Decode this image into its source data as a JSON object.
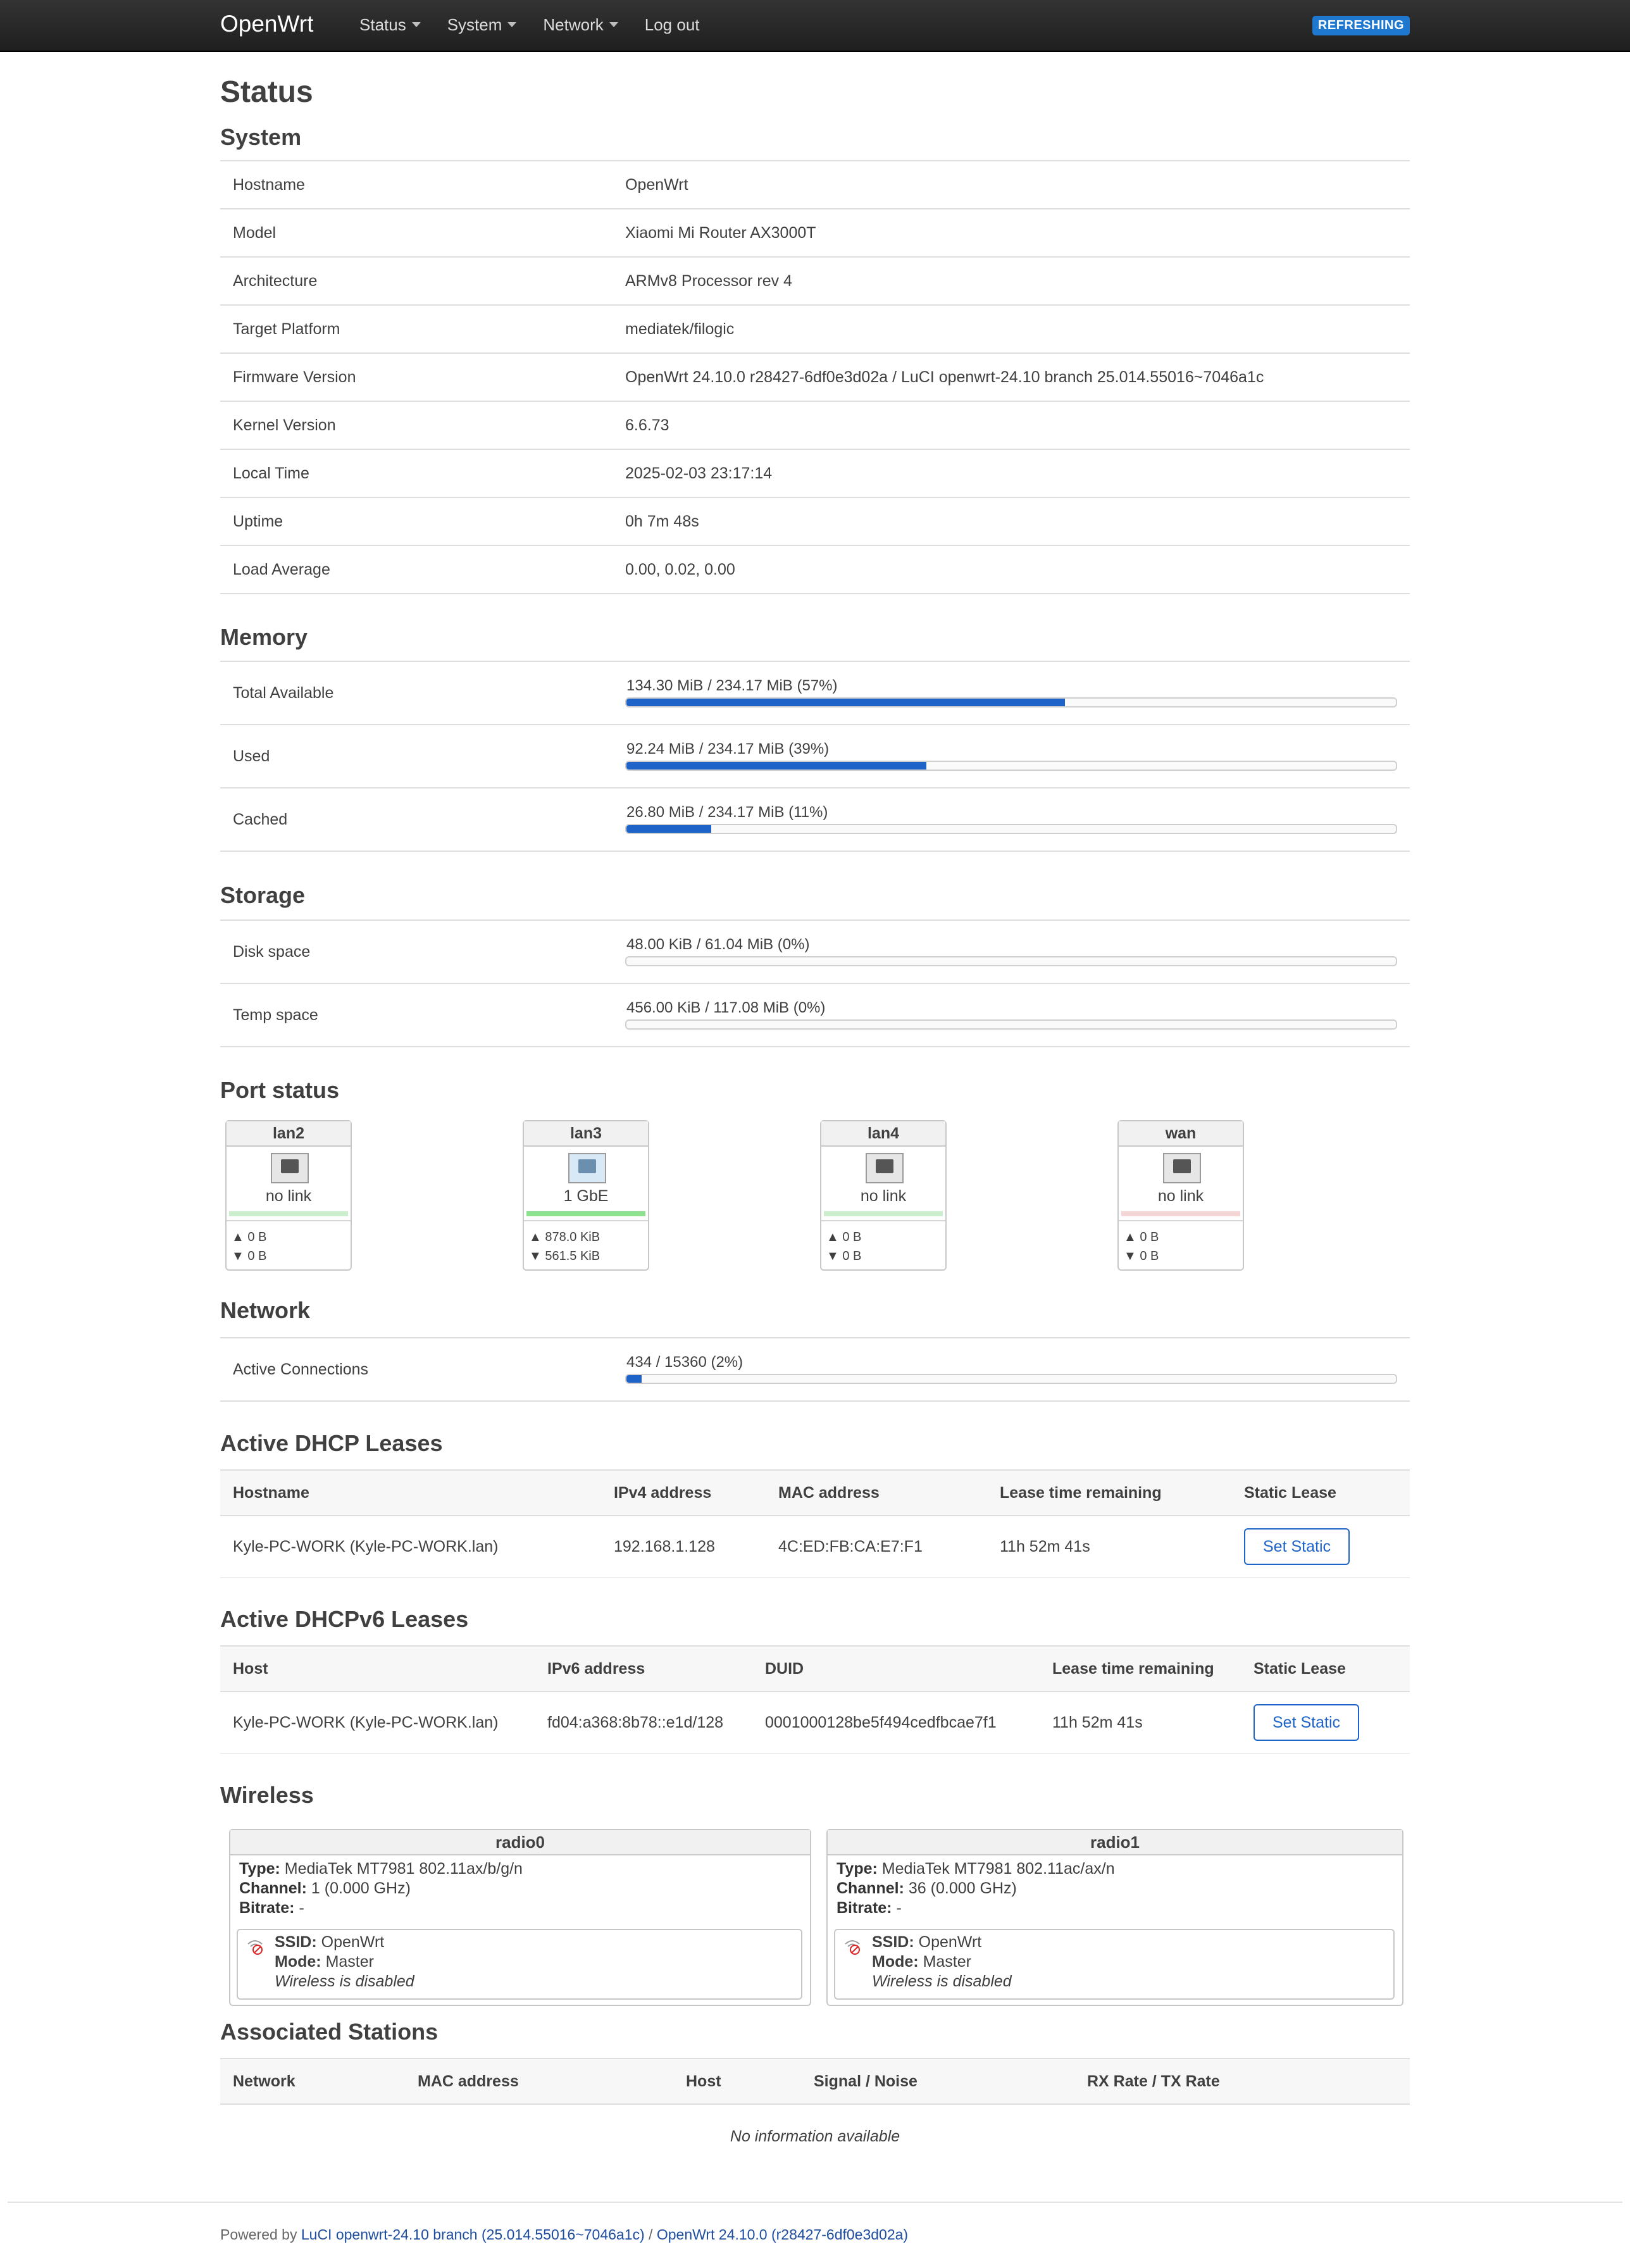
{
  "header": {
    "brand": "OpenWrt",
    "menu": [
      {
        "label": "Status",
        "dropdown": true
      },
      {
        "label": "System",
        "dropdown": true
      },
      {
        "label": "Network",
        "dropdown": true
      },
      {
        "label": "Log out",
        "dropdown": false
      }
    ],
    "badge": "REFRESHING"
  },
  "page_title": "Status",
  "system": {
    "title": "System",
    "rows": [
      {
        "label": "Hostname",
        "value": "OpenWrt"
      },
      {
        "label": "Model",
        "value": "Xiaomi Mi Router AX3000T"
      },
      {
        "label": "Architecture",
        "value": "ARMv8 Processor rev 4"
      },
      {
        "label": "Target Platform",
        "value": "mediatek/filogic"
      },
      {
        "label": "Firmware Version",
        "value": "OpenWrt 24.10.0 r28427-6df0e3d02a / LuCI openwrt-24.10 branch 25.014.55016~7046a1c"
      },
      {
        "label": "Kernel Version",
        "value": "6.6.73"
      },
      {
        "label": "Local Time",
        "value": "2025-02-03 23:17:14"
      },
      {
        "label": "Uptime",
        "value": "0h 7m 48s"
      },
      {
        "label": "Load Average",
        "value": "0.00, 0.02, 0.00"
      }
    ]
  },
  "memory": {
    "title": "Memory",
    "rows": [
      {
        "label": "Total Available",
        "text": "134.30 MiB / 234.17 MiB (57%)",
        "percent": 57
      },
      {
        "label": "Used",
        "text": "92.24 MiB / 234.17 MiB (39%)",
        "percent": 39
      },
      {
        "label": "Cached",
        "text": "26.80 MiB / 234.17 MiB (11%)",
        "percent": 11
      }
    ]
  },
  "storage": {
    "title": "Storage",
    "rows": [
      {
        "label": "Disk space",
        "text": "48.00 KiB / 61.04 MiB (0%)",
        "percent": 0
      },
      {
        "label": "Temp space",
        "text": "456.00 KiB / 117.08 MiB (0%)",
        "percent": 0
      }
    ]
  },
  "ports": {
    "title": "Port status",
    "items": [
      {
        "name": "lan2",
        "status": "no link",
        "tx": "▲ 0 B",
        "rx": "▼ 0 B",
        "led_color": "#cdeecd"
      },
      {
        "name": "lan3",
        "status": "1 GbE",
        "tx": "▲ 878.0 KiB",
        "rx": "▼ 561.5 KiB",
        "led_color": "#8fe08f"
      },
      {
        "name": "lan4",
        "status": "no link",
        "tx": "▲ 0 B",
        "rx": "▼ 0 B",
        "led_color": "#cdeecd"
      },
      {
        "name": "wan",
        "status": "no link",
        "tx": "▲ 0 B",
        "rx": "▼ 0 B",
        "led_color": "#f5d6d6"
      }
    ]
  },
  "network": {
    "title": "Network",
    "rows": [
      {
        "label": "Active Connections",
        "text": "434 / 15360 (2%)",
        "percent": 2
      }
    ]
  },
  "dhcp": {
    "title": "Active DHCP Leases",
    "headers": [
      "Hostname",
      "IPv4 address",
      "MAC address",
      "Lease time remaining",
      "Static Lease"
    ],
    "rows": [
      [
        "Kyle-PC-WORK (Kyle-PC-WORK.lan)",
        "192.168.1.128",
        "4C:ED:FB:CA:E7:F1",
        "11h 52m 41s",
        "Set Static"
      ]
    ]
  },
  "dhcpv6": {
    "title": "Active DHCPv6 Leases",
    "headers": [
      "Host",
      "IPv6 address",
      "DUID",
      "Lease time remaining",
      "Static Lease"
    ],
    "rows": [
      [
        "Kyle-PC-WORK (Kyle-PC-WORK.lan)",
        "fd04:a368:8b78::e1d/128",
        "0001000128be5f494cedfbcae7f1",
        "11h 52m 41s",
        "Set Static"
      ]
    ]
  },
  "wireless": {
    "title": "Wireless",
    "radios": [
      {
        "name": "radio0",
        "type_label": "Type:",
        "type": "MediaTek MT7981 802.11ax/b/g/n",
        "channel_label": "Channel:",
        "channel": "1 (0.000 GHz)",
        "bitrate_label": "Bitrate:",
        "bitrate": "-",
        "ssid_label": "SSID:",
        "ssid": "OpenWrt",
        "mode_label": "Mode:",
        "mode": "Master",
        "note": "Wireless is disabled"
      },
      {
        "name": "radio1",
        "type_label": "Type:",
        "type": "MediaTek MT7981 802.11ac/ax/n",
        "channel_label": "Channel:",
        "channel": "36 (0.000 GHz)",
        "bitrate_label": "Bitrate:",
        "bitrate": "-",
        "ssid_label": "SSID:",
        "ssid": "OpenWrt",
        "mode_label": "Mode:",
        "mode": "Master",
        "note": "Wireless is disabled"
      }
    ]
  },
  "stations": {
    "title": "Associated Stations",
    "headers": [
      "Network",
      "MAC address",
      "Host",
      "Signal / Noise",
      "RX Rate / TX Rate"
    ],
    "empty": "No information available"
  },
  "footer": {
    "prefix": "Powered by",
    "luci": "LuCI openwrt-24.10 branch (25.014.55016~7046a1c)",
    "sep": "/",
    "openwrt": "OpenWrt 24.10.0 (r28427-6df0e3d02a)"
  },
  "colors": {
    "accent": "#1e64c8",
    "badge": "#1e78d0",
    "header": "#2a2a2a"
  }
}
